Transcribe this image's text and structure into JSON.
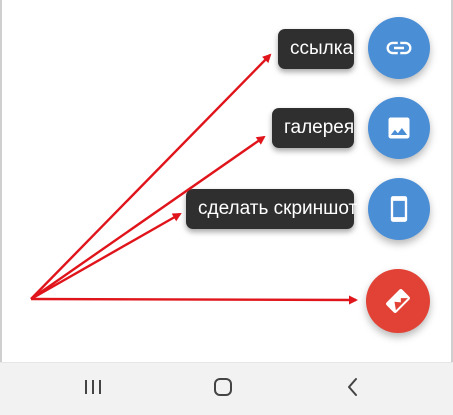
{
  "speed_dial": {
    "actions": [
      {
        "label": "ссылка",
        "icon": "link-icon"
      },
      {
        "label": "галерея",
        "icon": "image-icon"
      },
      {
        "label": "сделать скриншот",
        "icon": "smartphone-icon"
      }
    ],
    "main_fab": {
      "icon": "edit-sticker-icon"
    }
  },
  "navbar": {
    "buttons": [
      "recent-apps-icon",
      "home-icon",
      "back-icon"
    ]
  },
  "colors": {
    "fab_blue": "#4a8ed6",
    "fab_red": "#e14235",
    "chip_bg": "#2f2f2f",
    "arrow": "#e0141b",
    "navbar_bg": "#f2f2f2"
  }
}
